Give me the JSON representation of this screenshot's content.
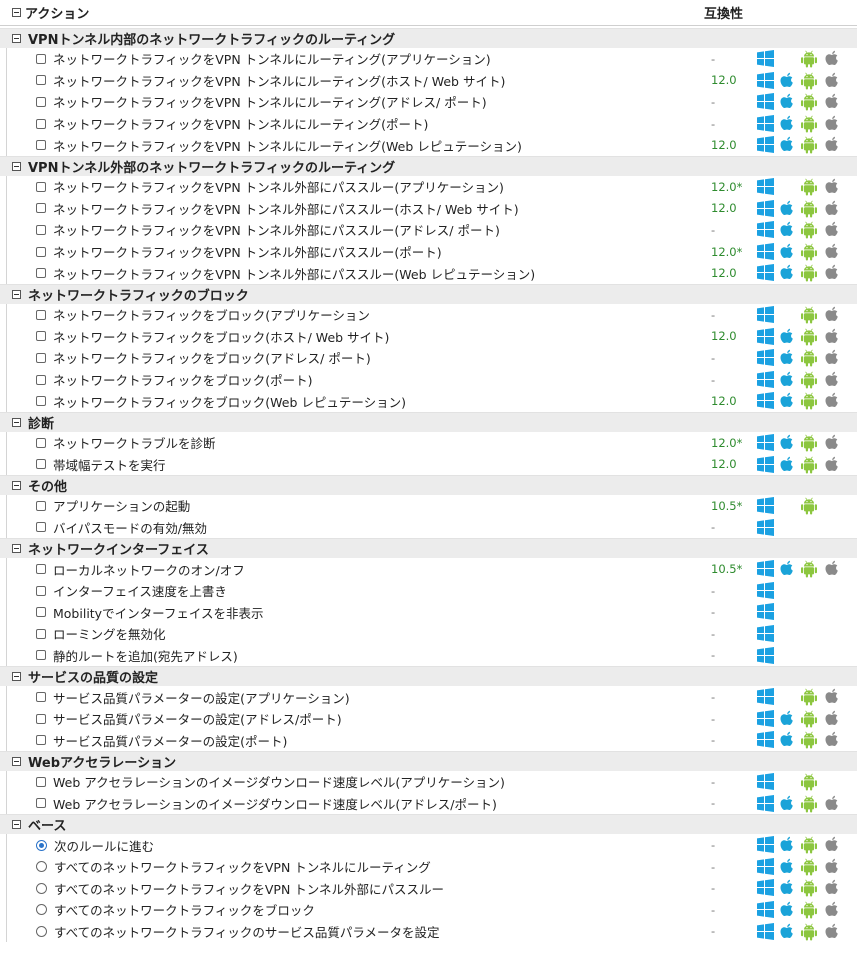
{
  "header": {
    "title": "アクション",
    "compat": "互換性"
  },
  "sections": [
    {
      "title": "VPNトンネル内部のネットワークトラフィックのルーティング",
      "items": [
        {
          "label": "ネットワークトラフィックをVPN トンネルにルーティング(アプリケーション)",
          "version": "-",
          "icons": [
            "win",
            "and",
            "ios"
          ]
        },
        {
          "label": "ネットワークトラフィックをVPN トンネルにルーティング(ホスト/ Web サイト)",
          "version": "12.0",
          "icons": [
            "win",
            "mac",
            "and",
            "ios"
          ]
        },
        {
          "label": "ネットワークトラフィックをVPN トンネルにルーティング(アドレス/ ポート)",
          "version": "-",
          "icons": [
            "win",
            "mac",
            "and",
            "ios"
          ]
        },
        {
          "label": "ネットワークトラフィックをVPN トンネルにルーティング(ポート)",
          "version": "-",
          "icons": [
            "win",
            "mac",
            "and",
            "ios"
          ]
        },
        {
          "label": "ネットワークトラフィックをVPN トンネルにルーティング(Web レピュテーション)",
          "version": "12.0",
          "icons": [
            "win",
            "mac",
            "and",
            "ios"
          ]
        }
      ]
    },
    {
      "title": "VPNトンネル外部のネットワークトラフィックのルーティング",
      "items": [
        {
          "label": "ネットワークトラフィックをVPN トンネル外部にパススルー(アプリケーション)",
          "version": "12.0*",
          "icons": [
            "win",
            "and",
            "ios"
          ]
        },
        {
          "label": "ネットワークトラフィックをVPN トンネル外部にパススルー(ホスト/ Web サイト)",
          "version": "12.0",
          "icons": [
            "win",
            "mac",
            "and",
            "ios"
          ]
        },
        {
          "label": "ネットワークトラフィックをVPN トンネル外部にパススルー(アドレス/ ポート)",
          "version": "-",
          "icons": [
            "win",
            "mac",
            "and",
            "ios"
          ]
        },
        {
          "label": "ネットワークトラフィックをVPN トンネル外部にパススルー(ポート)",
          "version": "12.0*",
          "icons": [
            "win",
            "mac",
            "and",
            "ios"
          ]
        },
        {
          "label": "ネットワークトラフィックをVPN トンネル外部にパススルー(Web レピュテーション)",
          "version": "12.0",
          "icons": [
            "win",
            "mac",
            "and",
            "ios"
          ]
        }
      ]
    },
    {
      "title": "ネットワークトラフィックのブロック",
      "items": [
        {
          "label": "ネットワークトラフィックをブロック(アプリケーション",
          "version": "-",
          "icons": [
            "win",
            "and",
            "ios"
          ]
        },
        {
          "label": "ネットワークトラフィックをブロック(ホスト/ Web サイト)",
          "version": "12.0",
          "icons": [
            "win",
            "mac",
            "and",
            "ios"
          ]
        },
        {
          "label": "ネットワークトラフィックをブロック(アドレス/ ポート)",
          "version": "-",
          "icons": [
            "win",
            "mac",
            "and",
            "ios"
          ]
        },
        {
          "label": "ネットワークトラフィックをブロック(ポート)",
          "version": "-",
          "icons": [
            "win",
            "mac",
            "and",
            "ios"
          ]
        },
        {
          "label": "ネットワークトラフィックをブロック(Web レピュテーション)",
          "version": "12.0",
          "icons": [
            "win",
            "mac",
            "and",
            "ios"
          ]
        }
      ]
    },
    {
      "title": "診断",
      "items": [
        {
          "label": "ネットワークトラブルを診断",
          "version": "12.0*",
          "icons": [
            "win",
            "mac",
            "and",
            "ios"
          ]
        },
        {
          "label": "帯域幅テストを実行",
          "version": "12.0",
          "icons": [
            "win",
            "mac",
            "and",
            "ios"
          ]
        }
      ]
    },
    {
      "title": "その他",
      "items": [
        {
          "label": "アプリケーションの起動",
          "version": "10.5*",
          "icons": [
            "win",
            "and"
          ]
        },
        {
          "label": "バイパスモードの有効/無効",
          "version": "-",
          "icons": [
            "win"
          ]
        }
      ]
    },
    {
      "title": "ネットワークインターフェイス",
      "items": [
        {
          "label": "ローカルネットワークのオン/オフ",
          "version": "10.5*",
          "icons": [
            "win",
            "mac",
            "and",
            "ios"
          ]
        },
        {
          "label": "インターフェイス速度を上書き",
          "version": "-",
          "icons": [
            "win"
          ]
        },
        {
          "label": "Mobilityでインターフェイスを非表示",
          "version": "-",
          "icons": [
            "win"
          ]
        },
        {
          "label": "ローミングを無効化",
          "version": "-",
          "icons": [
            "win"
          ]
        },
        {
          "label": "静的ルートを追加(宛先アドレス)",
          "version": "-",
          "icons": [
            "win"
          ]
        }
      ]
    },
    {
      "title": "サービスの品質の設定",
      "items": [
        {
          "label": "サービス品質パラメーターの設定(アプリケーション)",
          "version": "-",
          "icons": [
            "win",
            "and",
            "ios"
          ]
        },
        {
          "label": "サービス品質パラメーターの設定(アドレス/ポート)",
          "version": "-",
          "icons": [
            "win",
            "mac",
            "and",
            "ios"
          ]
        },
        {
          "label": "サービス品質パラメーターの設定(ポート)",
          "version": "-",
          "icons": [
            "win",
            "mac",
            "and",
            "ios"
          ]
        }
      ]
    },
    {
      "title": "Webアクセラレーション",
      "items": [
        {
          "label": "Web アクセラレーションのイメージダウンロード速度レベル(アプリケーション)",
          "version": "-",
          "icons": [
            "win",
            "and"
          ]
        },
        {
          "label": "Web アクセラレーションのイメージダウンロード速度レベル(アドレス/ポート)",
          "version": "-",
          "icons": [
            "win",
            "mac",
            "and",
            "ios"
          ]
        }
      ]
    },
    {
      "title": "ベース",
      "radio": true,
      "items": [
        {
          "label": "次のルールに進む",
          "version": "-",
          "icons": [
            "win",
            "mac",
            "and",
            "ios"
          ],
          "selected": true
        },
        {
          "label": "すべてのネットワークトラフィックをVPN トンネルにルーティング",
          "version": "-",
          "icons": [
            "win",
            "mac",
            "and",
            "ios"
          ]
        },
        {
          "label": "すべてのネットワークトラフィックをVPN トンネル外部にパススルー",
          "version": "-",
          "icons": [
            "win",
            "mac",
            "and",
            "ios"
          ]
        },
        {
          "label": "すべてのネットワークトラフィックをブロック",
          "version": "-",
          "icons": [
            "win",
            "mac",
            "and",
            "ios"
          ]
        },
        {
          "label": "すべてのネットワークトラフィックのサービス品質パラメータを設定",
          "version": "-",
          "icons": [
            "win",
            "mac",
            "and",
            "ios"
          ]
        }
      ]
    }
  ],
  "colors": {
    "windows": "#1ba1e2",
    "mac": "#1aa3d8",
    "android": "#8cc63f",
    "ios": "#8a8a8a",
    "version": "#2e8b2e"
  }
}
